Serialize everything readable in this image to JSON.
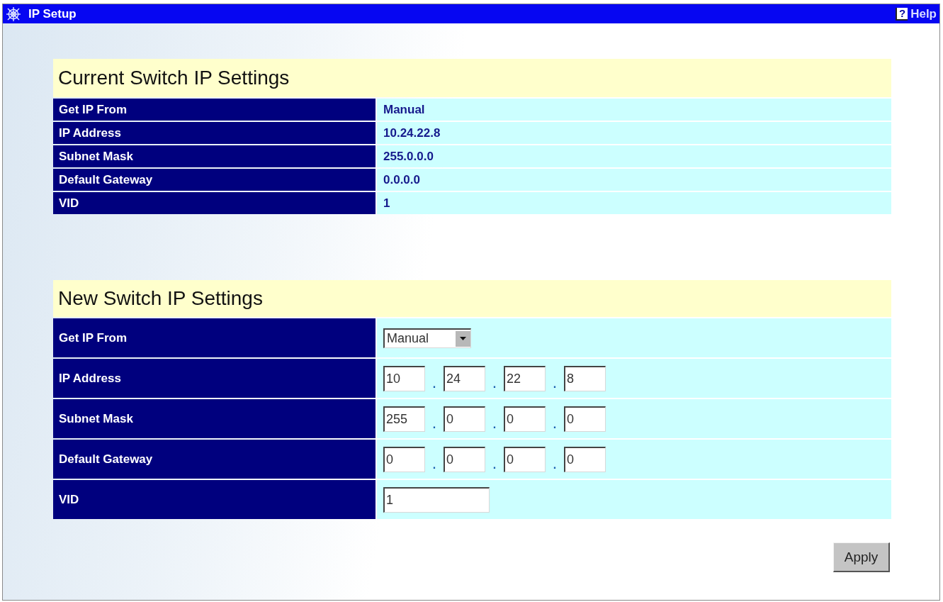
{
  "window": {
    "title": "IP Setup",
    "help_icon": "?",
    "help": "Help"
  },
  "current_settings": {
    "title": "Current Switch IP Settings",
    "rows": [
      {
        "label": "Get IP From",
        "value": "Manual"
      },
      {
        "label": "IP Address",
        "value": "10.24.22.8"
      },
      {
        "label": "Subnet Mask",
        "value": "255.0.0.0"
      },
      {
        "label": "Default Gateway",
        "value": "0.0.0.0"
      },
      {
        "label": "VID",
        "value": "1"
      }
    ]
  },
  "new_settings": {
    "title": "New Switch IP Settings",
    "rows": [
      {
        "label": "Get IP From",
        "kind": "select",
        "value": "Manual"
      },
      {
        "label": "IP Address",
        "kind": "octets",
        "octets": [
          "10",
          "24",
          "22",
          "8"
        ],
        "separators": [
          ".",
          ".",
          "."
        ]
      },
      {
        "label": "Subnet Mask",
        "kind": "octets",
        "octets": [
          "255",
          "0",
          "0",
          "0"
        ],
        "separators": [
          ".",
          ".",
          "."
        ]
      },
      {
        "label": "Default Gateway",
        "kind": "octets",
        "octets": [
          "0",
          "0",
          "0",
          "0"
        ],
        "separators": [
          ".",
          ".",
          "."
        ]
      },
      {
        "label": "VID",
        "kind": "text",
        "value": "1"
      }
    ]
  },
  "buttons": [
    "Apply"
  ]
}
